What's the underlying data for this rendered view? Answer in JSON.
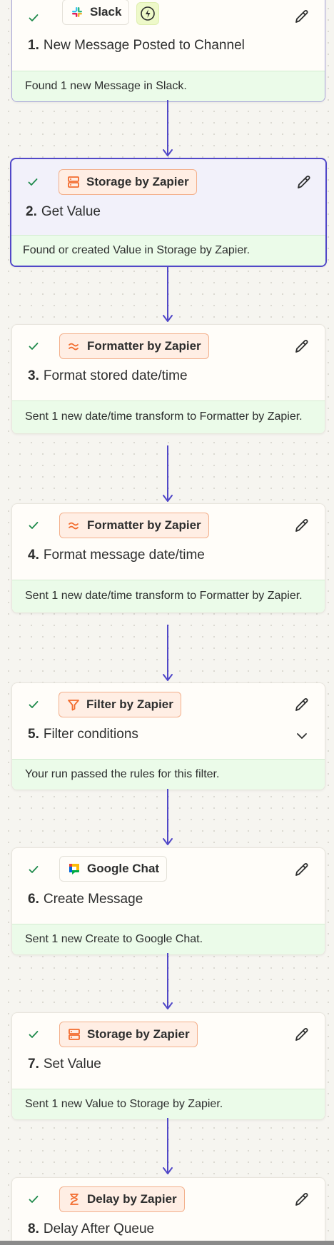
{
  "colors": {
    "accent": "#5148c8",
    "success_bg": "#ebfbe9",
    "check": "#1f8a4c",
    "app_orange": "#f26b2d"
  },
  "steps": [
    {
      "app": "Slack",
      "app_icon": "slack-icon",
      "number": "1.",
      "title": "New Message Posted to Channel",
      "status": "Found 1 new Message in Slack."
    },
    {
      "app": "Storage by Zapier",
      "app_icon": "storage-icon",
      "number": "2.",
      "title": "Get Value",
      "status": "Found or created Value in Storage by Zapier."
    },
    {
      "app": "Formatter by Zapier",
      "app_icon": "formatter-icon",
      "number": "3.",
      "title": "Format stored date/time",
      "status": "Sent 1 new date/time transform to Formatter by Zapier."
    },
    {
      "app": "Formatter by Zapier",
      "app_icon": "formatter-icon",
      "number": "4.",
      "title": "Format message date/time",
      "status": "Sent 1 new date/time transform to Formatter by Zapier."
    },
    {
      "app": "Filter by Zapier",
      "app_icon": "filter-icon",
      "number": "5.",
      "title": "Filter conditions",
      "status": "Your run passed the rules for this filter."
    },
    {
      "app": "Google Chat",
      "app_icon": "google-chat-icon",
      "number": "6.",
      "title": "Create Message",
      "status": "Sent 1 new Create to Google Chat."
    },
    {
      "app": "Storage by Zapier",
      "app_icon": "storage-icon",
      "number": "7.",
      "title": "Set Value",
      "status": "Sent 1 new Value to Storage by Zapier."
    },
    {
      "app": "Delay by Zapier",
      "app_icon": "delay-icon",
      "number": "8.",
      "title": "Delay After Queue",
      "status": ""
    }
  ]
}
